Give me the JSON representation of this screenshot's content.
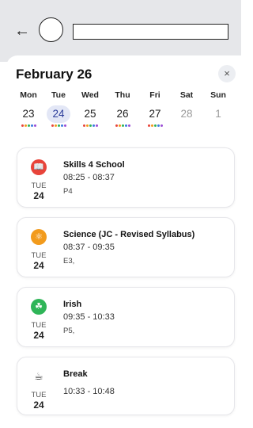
{
  "header": {
    "back_icon": "arrow-left-icon",
    "back_glyph": "←",
    "title_value": ""
  },
  "calendar": {
    "month_title": "February 26",
    "close_glyph": "×",
    "days": [
      {
        "name": "Mon",
        "num": "23",
        "dots": [
          "#e8443a",
          "#f29b1d",
          "#2fb558",
          "#3b7de0",
          "#9b4fd6"
        ],
        "selected": false,
        "muted": false
      },
      {
        "name": "Tue",
        "num": "24",
        "dots": [
          "#e8443a",
          "#f29b1d",
          "#2fb558",
          "#3b7de0",
          "#9b4fd6"
        ],
        "selected": true,
        "muted": false
      },
      {
        "name": "Wed",
        "num": "25",
        "dots": [
          "#e8443a",
          "#f29b1d",
          "#2fb558",
          "#3b7de0",
          "#9b4fd6"
        ],
        "selected": false,
        "muted": false
      },
      {
        "name": "Thu",
        "num": "26",
        "dots": [
          "#e8443a",
          "#f29b1d",
          "#2fb558",
          "#3b7de0",
          "#9b4fd6"
        ],
        "selected": false,
        "muted": false
      },
      {
        "name": "Fri",
        "num": "27",
        "dots": [
          "#e8443a",
          "#f29b1d",
          "#2fb558",
          "#3b7de0",
          "#9b4fd6"
        ],
        "selected": false,
        "muted": false
      },
      {
        "name": "Sat",
        "num": "28",
        "dots": [],
        "selected": false,
        "muted": true
      },
      {
        "name": "Sun",
        "num": "1",
        "dots": [],
        "selected": false,
        "muted": true
      }
    ]
  },
  "lessons": [
    {
      "subject": "Skills 4 School",
      "time": "08:25 - 08:37",
      "room": "P4",
      "dow": "TUE",
      "day": "24",
      "icon": "book-icon",
      "glyph": "📖",
      "color": "#e8443a"
    },
    {
      "subject": "Science (JC - Revised Syllabus)",
      "time": "08:37 - 09:35",
      "room": "E3,",
      "dow": "TUE",
      "day": "24",
      "icon": "atom-icon",
      "glyph": "⚛",
      "color": "#f29b1d"
    },
    {
      "subject": "Irish",
      "time": "09:35 - 10:33",
      "room": "P5,",
      "dow": "TUE",
      "day": "24",
      "icon": "shamrock-icon",
      "glyph": "☘",
      "color": "#2fb558"
    },
    {
      "subject": "Break",
      "time": "10:33 - 10:48",
      "room": "",
      "dow": "TUE",
      "day": "24",
      "icon": "coffee-cup-icon",
      "glyph": "☕",
      "color": ""
    }
  ]
}
